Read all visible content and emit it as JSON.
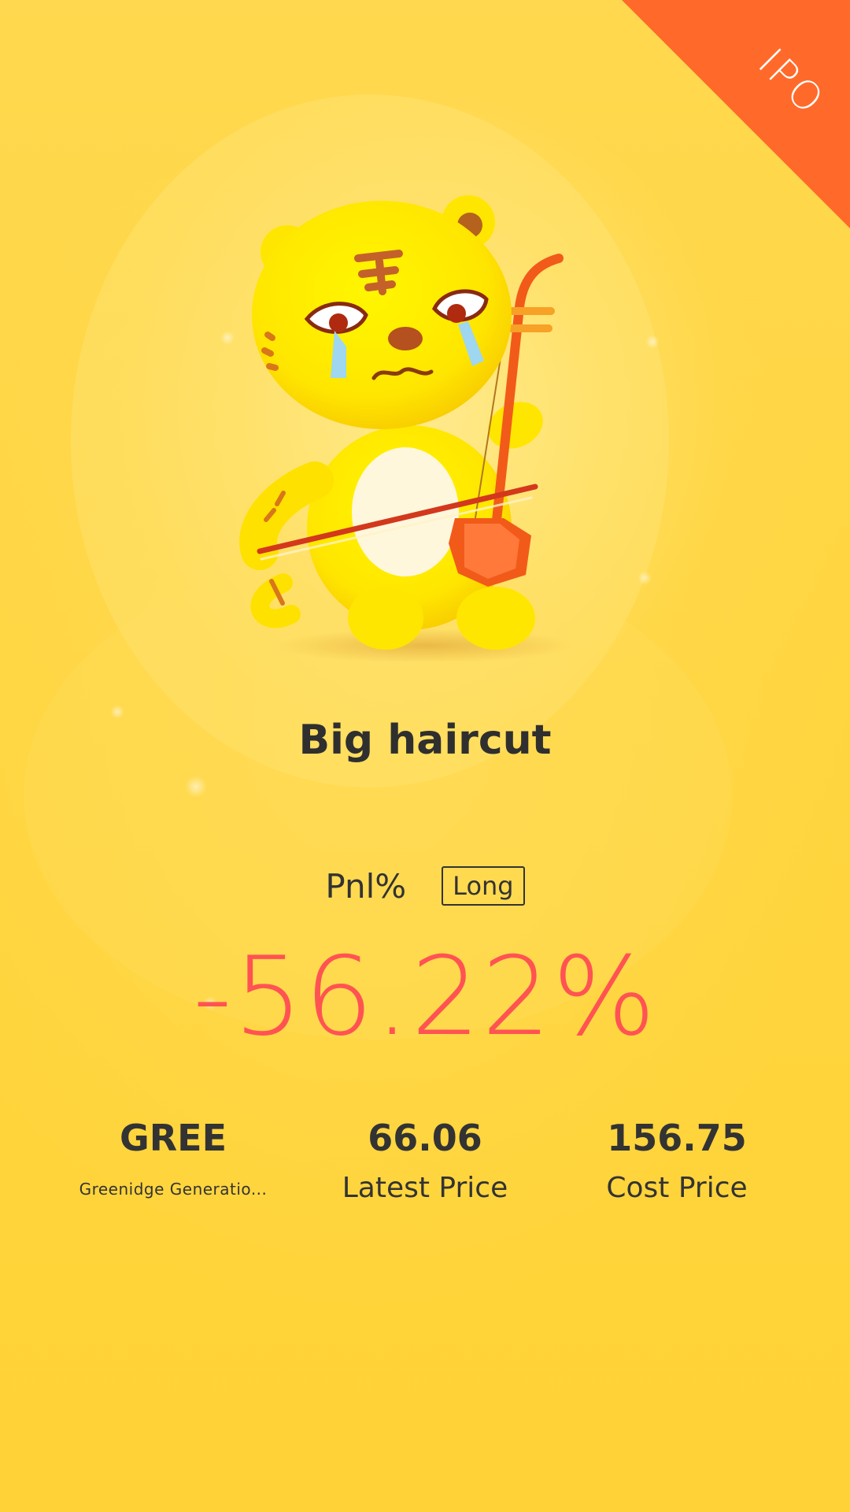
{
  "ribbon": {
    "text": "IPO"
  },
  "mascot": {
    "name": "crying-tiger-playing-erhu"
  },
  "headline": "Big haircut",
  "pnl": {
    "label": "Pnl%",
    "tag": "Long",
    "value": "-56.22%"
  },
  "stock": {
    "symbol": "GREE",
    "name": "Greenidge Generatio..."
  },
  "latest_price": {
    "value": "66.06",
    "label": "Latest Price"
  },
  "cost_price": {
    "value": "156.75",
    "label": "Cost Price"
  },
  "colors": {
    "background": "#ffd338",
    "ribbon": "#ff6a2b",
    "loss": "#ff5353",
    "text": "#333333"
  }
}
